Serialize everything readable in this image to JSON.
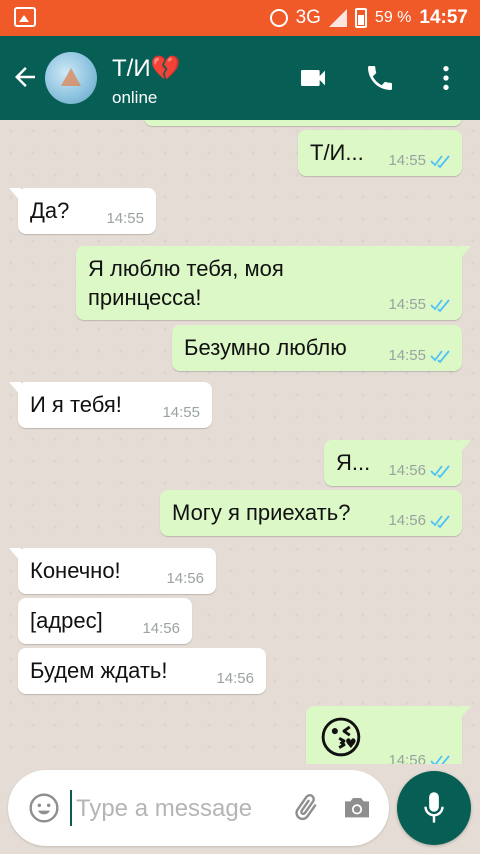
{
  "status_bar": {
    "network": "3G",
    "battery": "59 %",
    "time": "14:57"
  },
  "header": {
    "contact_name": "Т/И💔",
    "contact_status": "online",
    "icons": [
      "back-arrow-icon",
      "video-call-icon",
      "phone-icon",
      "more-vert-icon"
    ]
  },
  "messages": [
    {
      "direction": "out",
      "text": "Т/И...",
      "time": "14:55",
      "status": "read"
    },
    {
      "direction": "in",
      "text": "Да?",
      "time": "14:55"
    },
    {
      "direction": "out",
      "text": "Я люблю тебя, моя принцесса!",
      "time": "14:55",
      "status": "read"
    },
    {
      "direction": "out",
      "text": "Безумно люблю",
      "time": "14:55",
      "status": "read"
    },
    {
      "direction": "in",
      "text": "И я тебя!",
      "time": "14:55"
    },
    {
      "direction": "out",
      "text": "Я...",
      "time": "14:56",
      "status": "read"
    },
    {
      "direction": "out",
      "text": "Могу я приехать?",
      "time": "14:56",
      "status": "read"
    },
    {
      "direction": "in",
      "text": "Конечно!",
      "time": "14:56"
    },
    {
      "direction": "in",
      "text": "[адрес]",
      "time": "14:56"
    },
    {
      "direction": "in",
      "text": "Будем ждать!",
      "time": "14:56"
    },
    {
      "direction": "out",
      "text": "😘",
      "time": "14:56",
      "status": "read"
    }
  ],
  "input": {
    "placeholder": "Type a message",
    "value": ""
  },
  "colors": {
    "status_bar": "#f05a28",
    "header": "#075e54",
    "outgoing_bubble": "#dcf8c6",
    "incoming_bubble": "#ffffff",
    "read_ticks": "#4fc3f7",
    "chat_background": "#e5ddd5"
  }
}
